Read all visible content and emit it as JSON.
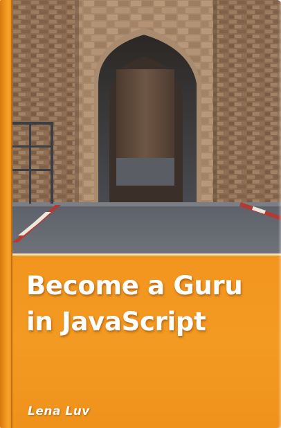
{
  "book": {
    "title_line1": "Become a Guru",
    "title_line2": "in JavaScript",
    "author": "Lena Luv"
  },
  "cover_photo": {
    "subject": "stone archway gate"
  },
  "colors": {
    "cover_orange": "#f39a22",
    "spine_orange": "#f0961d",
    "text": "#ffffff"
  }
}
